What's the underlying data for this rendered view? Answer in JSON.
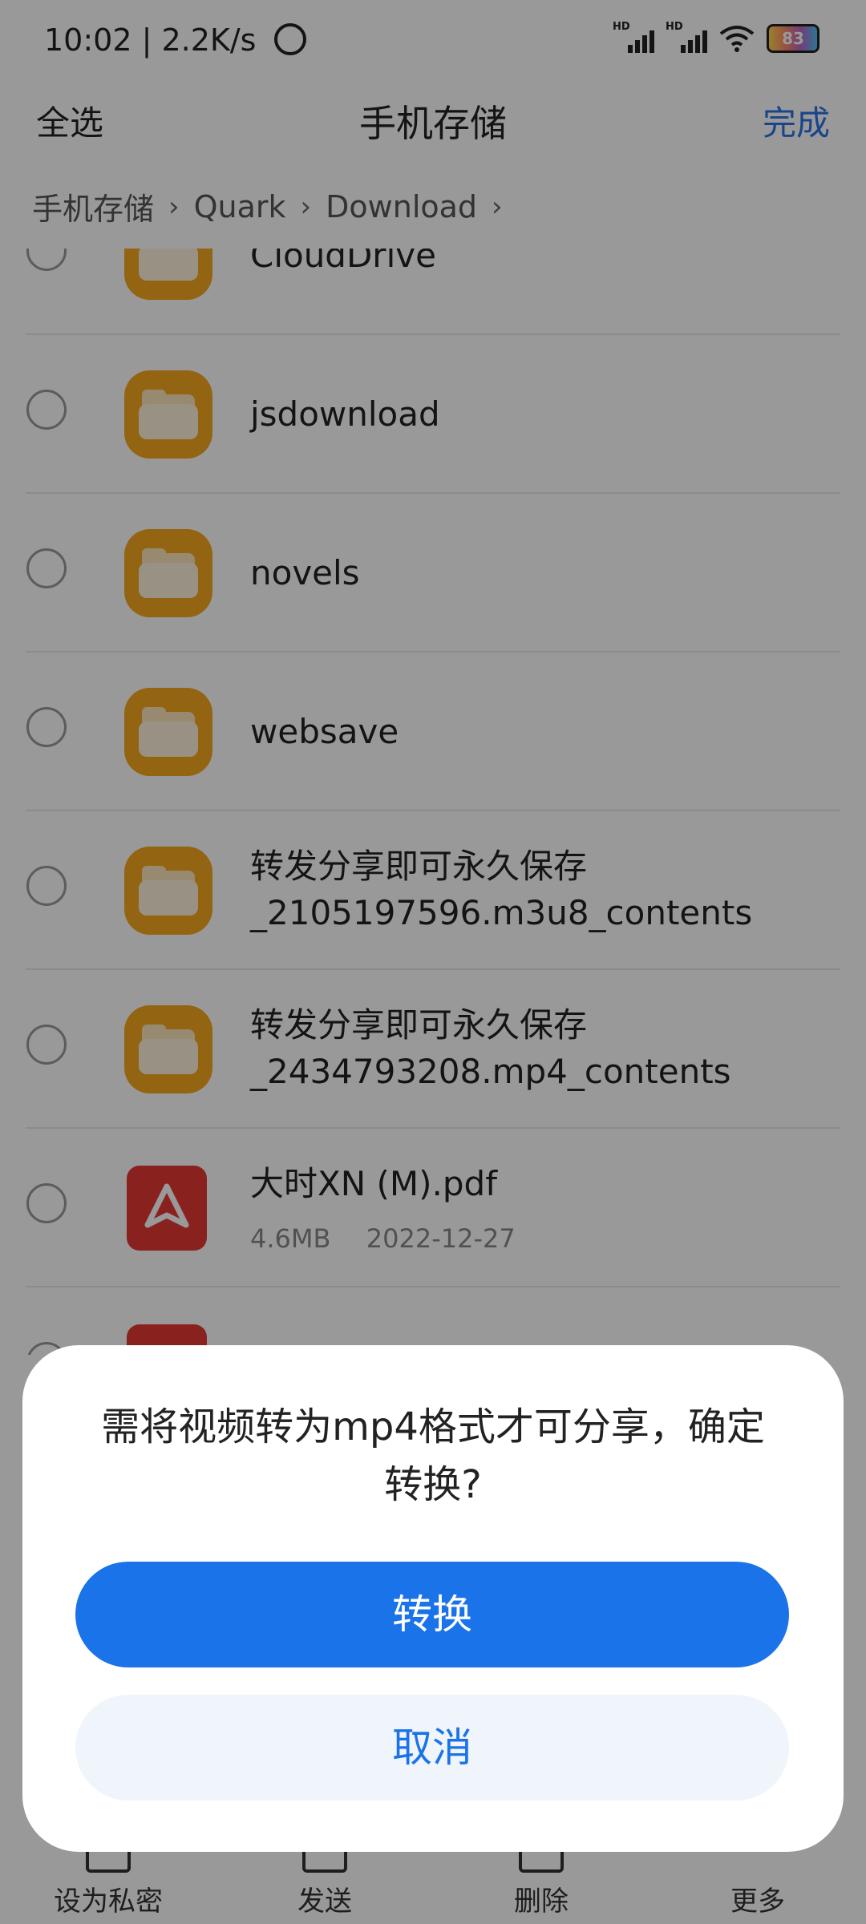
{
  "status_bar": {
    "time_speed": "10:02 | 2.2K/s",
    "hd_label": "HD",
    "battery_level": "83"
  },
  "header": {
    "select_all": "全选",
    "title": "手机存储",
    "done": "完成"
  },
  "breadcrumb": [
    "手机存储",
    "Quark",
    "Download"
  ],
  "files": [
    {
      "name": "CloudDrive",
      "type": "folder"
    },
    {
      "name": "jsdownload",
      "type": "folder"
    },
    {
      "name": "novels",
      "type": "folder"
    },
    {
      "name": "websave",
      "type": "folder"
    },
    {
      "name_line1": "转发分享即可永久保存",
      "name_line2": "_2105197596.m3u8_contents",
      "type": "folder"
    },
    {
      "name_line1": "转发分享即可永久保存",
      "name_line2": "_2434793208.mp4_contents",
      "type": "folder"
    },
    {
      "name": "大时XN (M).pdf",
      "size": "4.6MB",
      "date": "2022-12-27",
      "type": "pdf"
    }
  ],
  "toolbar": {
    "private": "设为私密",
    "send": "发送",
    "delete": "删除",
    "more": "更多"
  },
  "dialog": {
    "message": "需将视频转为mp4格式才可分享，确定转换?",
    "confirm": "转换",
    "cancel": "取消"
  },
  "colors": {
    "accent": "#1a73e8",
    "folder": "#f6a71f",
    "pdf": "#e53935"
  }
}
